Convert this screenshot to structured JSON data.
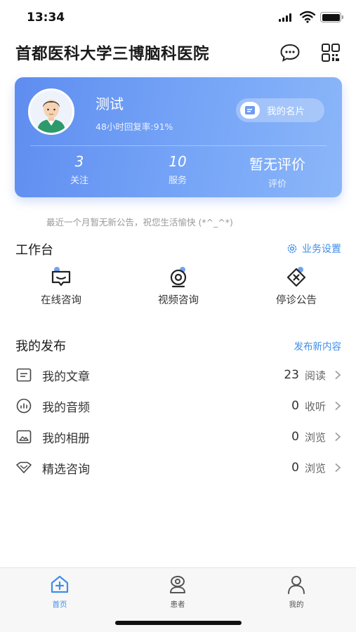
{
  "status_bar": {
    "time": "13:34"
  },
  "header": {
    "title": "首都医科大学三博脑科医院",
    "icons": [
      "message-icon",
      "qr-code-icon"
    ]
  },
  "profile": {
    "name": "测试",
    "reply_rate": "48小时回复率:91%",
    "namecard_label": "我的名片",
    "stats": [
      {
        "value": "3",
        "label": "关注"
      },
      {
        "value": "10",
        "label": "服务"
      },
      {
        "value": "暂无评价",
        "label": "评价"
      }
    ]
  },
  "notice": "最近一个月暂无新公告，祝您生活愉快 (*^_^*)",
  "workbench": {
    "title": "工作台",
    "settings_label": "业务设置",
    "items": [
      {
        "label": "在线咨询",
        "icon": "online-consult-icon"
      },
      {
        "label": "视频咨询",
        "icon": "video-consult-icon"
      },
      {
        "label": "停诊公告",
        "icon": "suspension-notice-icon"
      }
    ]
  },
  "publish": {
    "title": "我的发布",
    "new_label": "发布新内容",
    "rows": [
      {
        "label": "我的文章",
        "count": "23",
        "unit": "阅读",
        "icon": "article-icon"
      },
      {
        "label": "我的音频",
        "count": "0",
        "unit": "收听",
        "icon": "audio-icon"
      },
      {
        "label": "我的相册",
        "count": "0",
        "unit": "浏览",
        "icon": "album-icon"
      },
      {
        "label": "精选咨询",
        "count": "0",
        "unit": "浏览",
        "icon": "featured-consult-icon"
      }
    ]
  },
  "tabbar": {
    "tabs": [
      {
        "label": "首页",
        "active": true
      },
      {
        "label": "患者",
        "active": false
      },
      {
        "label": "我的",
        "active": false
      }
    ]
  },
  "colors": {
    "accent": "#3f8ee8",
    "card_gradient_start": "#5f8df0",
    "card_gradient_end": "#8bb6f9",
    "text": "#333333",
    "muted": "#999999"
  }
}
